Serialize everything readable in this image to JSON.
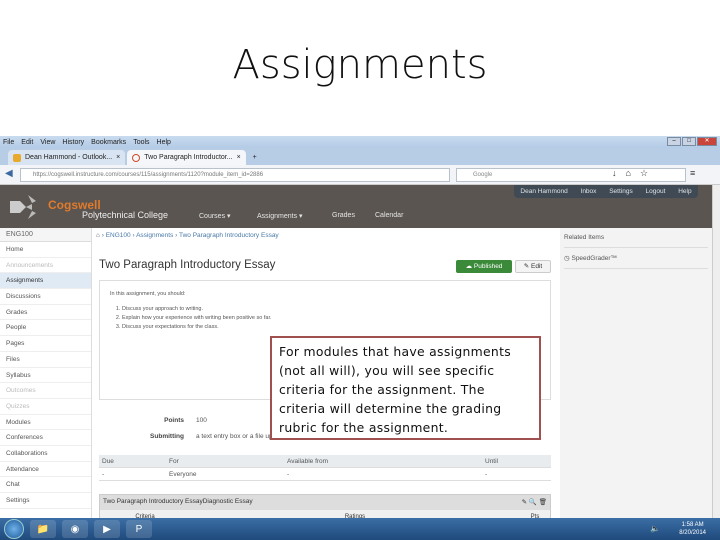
{
  "slide": {
    "title": "Assignments",
    "callout": "For modules that have assignments (not all will), you will see specific criteria for the assignment. The criteria will determine the grading rubric for the assignment."
  },
  "browser": {
    "menu": [
      "File",
      "Edit",
      "View",
      "History",
      "Bookmarks",
      "Tools",
      "Help"
    ],
    "tabs": [
      {
        "label": "Dean Hammond - Outlook..."
      },
      {
        "label": "Two Paragraph Introductor..."
      }
    ],
    "new_tab": "+",
    "url": "https://cogswell.instructure.com/courses/115/assignments/1120?module_item_id=2886",
    "search_placeholder": "Google"
  },
  "canvas": {
    "logo_name": "Cogswell",
    "logo_sub": "Polytechnical College",
    "nav": [
      "Courses ▾",
      "Assignments ▾",
      "Grades",
      "Calendar"
    ],
    "user_menu": [
      "Dean Hammond",
      "Inbox",
      "Settings",
      "Logout",
      "Help"
    ],
    "course": "ENG100",
    "sidebar": [
      {
        "label": "Home"
      },
      {
        "label": "Announcements",
        "dim": true
      },
      {
        "label": "Assignments",
        "active": true
      },
      {
        "label": "Discussions"
      },
      {
        "label": "Grades"
      },
      {
        "label": "People"
      },
      {
        "label": "Pages"
      },
      {
        "label": "Files"
      },
      {
        "label": "Syllabus"
      },
      {
        "label": "Outcomes",
        "dim": true
      },
      {
        "label": "Quizzes",
        "dim": true
      },
      {
        "label": "Modules"
      },
      {
        "label": "Conferences"
      },
      {
        "label": "Collaborations"
      },
      {
        "label": "Attendance"
      },
      {
        "label": "Chat"
      },
      {
        "label": "Settings"
      }
    ],
    "breadcrumb": [
      "ENG100",
      "Assignments",
      "Two Paragraph Introductory Essay"
    ],
    "title": "Two Paragraph Introductory Essay",
    "published": "Published",
    "edit": "Edit",
    "intro": "In this assignment, you should:",
    "steps": [
      "Discuss your approach to writing.",
      "Explain how your experience with writing been positive so far.",
      "Discuss your expectations for the class."
    ],
    "points_label": "Points",
    "points": "100",
    "submitting_label": "Submitting",
    "submitting": "a text entry box or a file upload",
    "dates_headers": [
      "Due",
      "For",
      "Available from",
      "Until"
    ],
    "dates_row": [
      "-",
      "Everyone",
      "-",
      "-"
    ],
    "rubric_title": "Two Paragraph Introductory EssayDiagnostic Essay",
    "rubric_headers": [
      "Criteria",
      "Ratings",
      "Pts"
    ],
    "related_title": "Related Items",
    "speedgrader": "SpeedGrader™"
  },
  "taskbar": {
    "time": "1:58 AM",
    "date": "8/20/2014"
  }
}
